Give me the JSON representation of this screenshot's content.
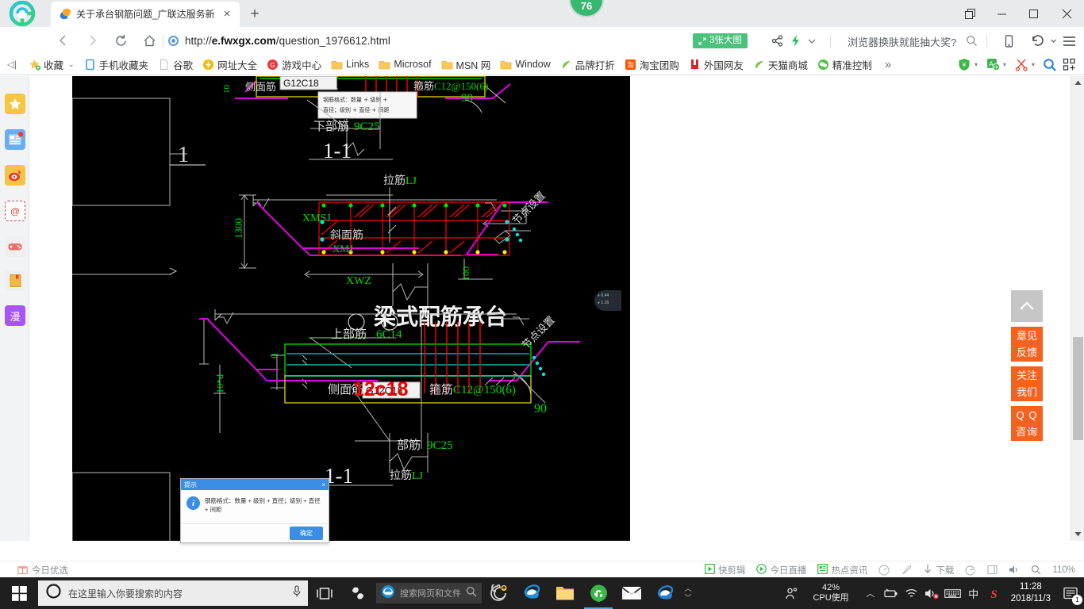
{
  "browser": {
    "tab": {
      "title": "关于承台钢筋问题_广联达服务新",
      "favicon": "browser-favicon",
      "close": "×"
    },
    "newtab_label": "+",
    "badge_count": "76",
    "window_controls": [
      {
        "name": "restore-down-button",
        "glyph": "❐"
      },
      {
        "name": "minimize-button",
        "glyph": "—"
      },
      {
        "name": "maximize-button",
        "glyph": "▢"
      },
      {
        "name": "close-button",
        "glyph": "✕"
      }
    ],
    "nav": {
      "back": "‹",
      "forward": "›",
      "reload": "↻",
      "home": "⌂"
    },
    "url": {
      "scheme": "http://",
      "host": "e.fwxgx.com",
      "path": "/question_1976612.html"
    },
    "bigpic_label": "3张大图",
    "promo_text": "浏览器换肤就能抽大奖?",
    "nav_icons": [
      {
        "name": "share-icon",
        "glyph": "share"
      },
      {
        "name": "lightning-icon",
        "glyph": "bolt"
      },
      {
        "name": "chevron-down-icon",
        "glyph": "⌄"
      },
      {
        "name": "search-icon",
        "glyph": "search"
      },
      {
        "name": "mobile-view-icon",
        "glyph": "phone"
      },
      {
        "name": "history-back-icon",
        "glyph": "undo"
      },
      {
        "name": "menu-icon",
        "glyph": "hamburger"
      }
    ]
  },
  "bookmarks": {
    "collapse_glyph": "◁|",
    "items": [
      {
        "label": "收藏",
        "icon": "star-folder-icon",
        "caret": "⌄"
      },
      {
        "label": "手机收藏夹",
        "icon": "mobile-favorites-icon"
      },
      {
        "label": "谷歌",
        "icon": "page-icon"
      },
      {
        "label": "网址大全",
        "icon": "hao-icon"
      },
      {
        "label": "游戏中心",
        "icon": "game-center-icon"
      },
      {
        "label": "Links",
        "icon": "folder-icon"
      },
      {
        "label": "Microsof",
        "icon": "folder-icon"
      },
      {
        "label": "MSN 网",
        "icon": "folder-icon"
      },
      {
        "label": "Window",
        "icon": "folder-icon"
      },
      {
        "label": "品牌打折",
        "icon": "leaf-icon"
      },
      {
        "label": "淘宝团购",
        "icon": "taobao-icon"
      },
      {
        "label": "外国网友",
        "icon": "flag-icon"
      },
      {
        "label": "天猫商城",
        "icon": "leaf-icon"
      },
      {
        "label": "精准控制",
        "icon": "wechat-icon"
      }
    ],
    "overflow_glyph": "»",
    "right_icons": [
      {
        "name": "shield-yuan-icon",
        "glyph": "¥"
      },
      {
        "name": "translate-icon",
        "glyph": "A中"
      },
      {
        "name": "scissors-icon",
        "glyph": "✂"
      },
      {
        "name": "magnifier-icon",
        "glyph": "🔍"
      },
      {
        "name": "apps-grid-icon",
        "glyph": "grid"
      }
    ]
  },
  "left_rail": [
    {
      "name": "favorites-star-icon",
      "glyph": "★",
      "bg": "#f9c440",
      "fg": "#ffffff"
    },
    {
      "name": "news-feed-icon",
      "glyph": "▤",
      "bg": "#6aaef0",
      "fg": "#ffffff",
      "dot": true
    },
    {
      "name": "weibo-icon",
      "glyph": "◉",
      "bg": "#f6c344",
      "fg": "#e0422e"
    },
    {
      "name": "mail-icon",
      "glyph": "@",
      "bg": "#ffffff",
      "fg": "#e0422e"
    },
    {
      "name": "game-pad-icon",
      "glyph": "▬",
      "bg": "#efefef",
      "fg": "#e06666"
    },
    {
      "name": "novel-book-icon",
      "glyph": "▮",
      "bg": "#efefef",
      "fg": "#e8a33d"
    },
    {
      "name": "comic-icon",
      "glyph": "漫",
      "bg": "#a855f7",
      "fg": "#ffffff"
    }
  ],
  "right_widgets": {
    "back_to_top": {
      "name": "back-to-top-button",
      "glyph": "︿"
    },
    "buttons": [
      {
        "name": "feedback-button",
        "line1": "意见",
        "line2": "反馈"
      },
      {
        "name": "follow-us-button",
        "line1": "关注",
        "line2": "我们"
      },
      {
        "name": "qq-consult-button",
        "line1": "Q Q",
        "line2": "咨询"
      }
    ]
  },
  "cad": {
    "section_top": {
      "side_bar_label": "侧面筋",
      "side_bar_value": "G12C18",
      "stirrup_label": "箍筋",
      "stirrup_value": "C12@150(6)",
      "bottom_label": "下部筋",
      "bottom_value": "9C25",
      "angle": "90",
      "section_mark": "1-1",
      "tooltip_line1": "钢筋格式：数量 + 级别 +",
      "tooltip_line2": "直径；级别 + 直径 + 间距",
      "left_dim": "10"
    },
    "section_mid": {
      "tie_label": "拉筋",
      "tie_value": "LJ",
      "height_dim": "1300",
      "slope_label": "斜面筋",
      "slope_value": "XMJ",
      "xwz": "XWZ",
      "xmsj": "XMSJ",
      "node_note": "节点设置",
      "small_dim": "100",
      "callout_number": "1"
    },
    "title_text": "梁式配筋承台",
    "section_bottom": {
      "top_bar_label": "上部筋",
      "top_bar_value": "6C14",
      "side_bar_label": "侧面筋",
      "side_bar_value": "G12C18",
      "side_bar_overlay": "12c18",
      "stirrup_label": "箍筋",
      "stirrup_value": "C12@150(6)",
      "bottom_label": "部筋",
      "bottom_value": "9C25",
      "angle": "90",
      "section_mark": "1-1",
      "tie_label": "拉筋",
      "tie_value": "LJ",
      "node_note": "节点设置",
      "dim_a": "0",
      "dim_b": "10*d"
    },
    "colors": {
      "background": "#000000",
      "green_text": "#00e000",
      "white_line": "#c8c8c8",
      "magenta": "#e000e0",
      "red": "#ff0000",
      "yellow": "#f0f000",
      "cyan": "#00e0e0",
      "overlay_red": "#ee0000"
    }
  },
  "edge_chip": {
    "l1": "0.44",
    "l2": "1.16"
  },
  "dialog": {
    "title": "提示",
    "close_glyph": "×",
    "message": "钢筋格式：数量 + 级别 + 直径；级别 + 直径 + 间距",
    "ok_label": "确定"
  },
  "statusbar": {
    "left": {
      "icon": "gift-icon",
      "label": "今日优选"
    },
    "right_items": [
      {
        "name": "quick-edit-button",
        "label": "快剪辑",
        "icon": "play-box-icon"
      },
      {
        "name": "live-today-button",
        "label": "今日直播",
        "icon": "live-circle-icon"
      },
      {
        "name": "hot-news-button",
        "label": "热点资讯",
        "icon": "news-box-icon"
      },
      {
        "name": "speed-icon",
        "label": "",
        "icon": "speed-icon"
      },
      {
        "name": "rocket-icon",
        "label": "",
        "icon": "rocket-icon"
      },
      {
        "name": "downloads-button",
        "label": "下载",
        "icon": "download-arrow-icon"
      },
      {
        "name": "browser-e-icon",
        "label": "",
        "icon": "browser-e-icon"
      },
      {
        "name": "window-split-icon",
        "label": "",
        "icon": "window-split-icon"
      },
      {
        "name": "volume-icon",
        "label": "",
        "icon": "volume-icon"
      },
      {
        "name": "zoom-search-icon",
        "label": "",
        "icon": "magnifier-icon"
      },
      {
        "name": "zoom-level",
        "label": "110%",
        "icon": ""
      }
    ]
  },
  "taskbar": {
    "start_glyph": "⊞",
    "search_placeholder": "在这里输入你要搜索的内容",
    "mic_icon": "mic-icon",
    "cortana_icon": "cortana-circle-icon",
    "pinned": [
      {
        "name": "taskview-button",
        "icon": "task-view-icon"
      },
      {
        "name": "app-s-button",
        "icon": "s-app-icon"
      }
    ],
    "ie_search_placeholder": "搜索网页和文件",
    "apps": [
      {
        "name": "taskbar-app-chrome-like",
        "icon": "spiral-icon"
      },
      {
        "name": "taskbar-app-ie",
        "icon": "ie-icon"
      },
      {
        "name": "taskbar-app-explorer",
        "icon": "folder-icon"
      },
      {
        "name": "taskbar-app-browser-active",
        "icon": "e-browser-icon",
        "active": true
      },
      {
        "name": "taskbar-app-mail",
        "icon": "mail-icon"
      },
      {
        "name": "taskbar-app-edge",
        "icon": "edge-icon"
      }
    ],
    "tray": {
      "people_icon": "people-icon",
      "cpu_line1": "42%",
      "cpu_line2": "CPU使用",
      "chevron": "︿",
      "icons": [
        {
          "name": "battery-icon",
          "glyph": "battery"
        },
        {
          "name": "wifi-icon",
          "glyph": "wifi"
        },
        {
          "name": "volume-muted-icon",
          "glyph": "volume-x"
        },
        {
          "name": "keyboard-icon",
          "glyph": "keyboard"
        },
        {
          "name": "ime-chinese-icon",
          "glyph": "中"
        },
        {
          "name": "sogou-icon",
          "glyph": "S"
        }
      ],
      "time": "11:28",
      "date": "2018/11/3",
      "notification_count": "1"
    }
  }
}
